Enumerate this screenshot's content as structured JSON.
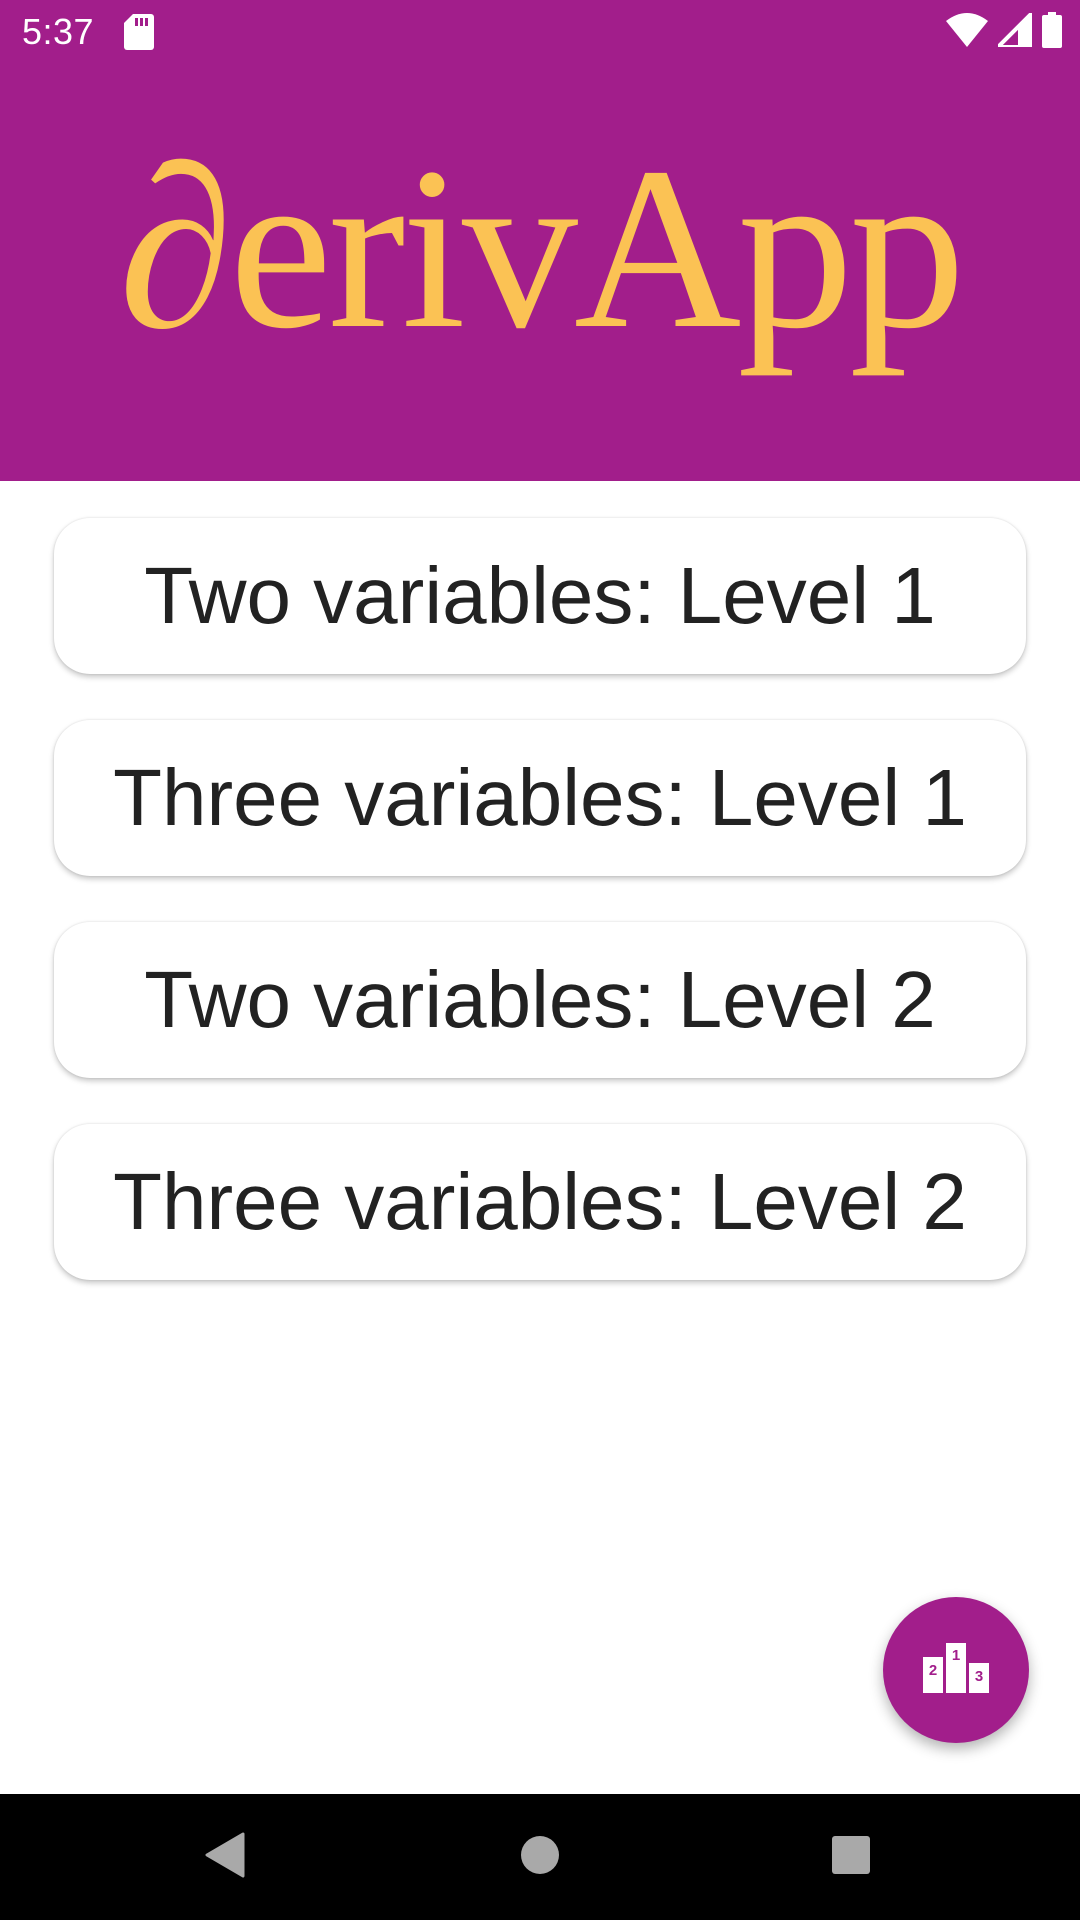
{
  "status_bar": {
    "time": "5:37",
    "icons": [
      "sd-card-icon",
      "wifi-icon",
      "signal-icon",
      "battery-icon"
    ]
  },
  "header": {
    "logo_text": "∂erivApp"
  },
  "levels": [
    {
      "label": "Two variables: Level 1"
    },
    {
      "label": "Three variables: Level 1"
    },
    {
      "label": "Two variables: Level 2"
    },
    {
      "label": "Three variables: Level 2"
    }
  ],
  "fab": {
    "icon": "leaderboard-podium-icon",
    "podium_labels": [
      "2",
      "1",
      "3"
    ]
  },
  "nav_bar": {
    "icons": [
      "back-icon",
      "home-icon",
      "recents-icon"
    ]
  },
  "colors": {
    "primary": "#a21e8b",
    "logo": "#fbc254",
    "button_text": "#222222",
    "background": "#ffffff"
  }
}
